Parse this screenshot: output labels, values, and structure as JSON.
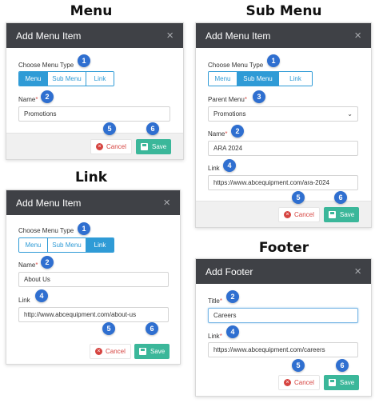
{
  "sections": {
    "menu": "Menu",
    "sub_menu": "Sub Menu",
    "link": "Link",
    "footer": "Footer"
  },
  "labels": {
    "add_menu_item": "Add Menu Item",
    "add_footer": "Add Footer",
    "choose_menu_type": "Choose Menu Type",
    "name": "Name",
    "parent_menu": "Parent Menu",
    "link": "Link",
    "title": "Title",
    "required_mark": "*",
    "close": "×",
    "cancel": "Cancel",
    "save": "Save",
    "cancel_icon": "×"
  },
  "menu_types": [
    "Menu",
    "Sub Menu",
    "Link"
  ],
  "values": {
    "menu_name": "Promotions",
    "submenu_parent": "Promotions",
    "submenu_name": "ARA 2024",
    "submenu_link": "https://www.abcequipment.com/ara-2024",
    "link_name": "About Us",
    "link_url": "http://www.abcequipment.com/about-us",
    "footer_title": "Careers",
    "footer_link": "https://www.abcequipment.com/careers"
  },
  "badges": [
    "1",
    "2",
    "3",
    "4",
    "5",
    "6"
  ],
  "icons": {
    "close": "close-icon",
    "cancel": "x-circle-icon",
    "save": "floppy-disk-icon",
    "dropdown": "chevron-down-icon"
  },
  "colors": {
    "header": "#3f4146",
    "segment_active": "#2f9bd6",
    "badge": "#2f6fd0",
    "save": "#3bb79a",
    "cancel": "#d64541"
  }
}
